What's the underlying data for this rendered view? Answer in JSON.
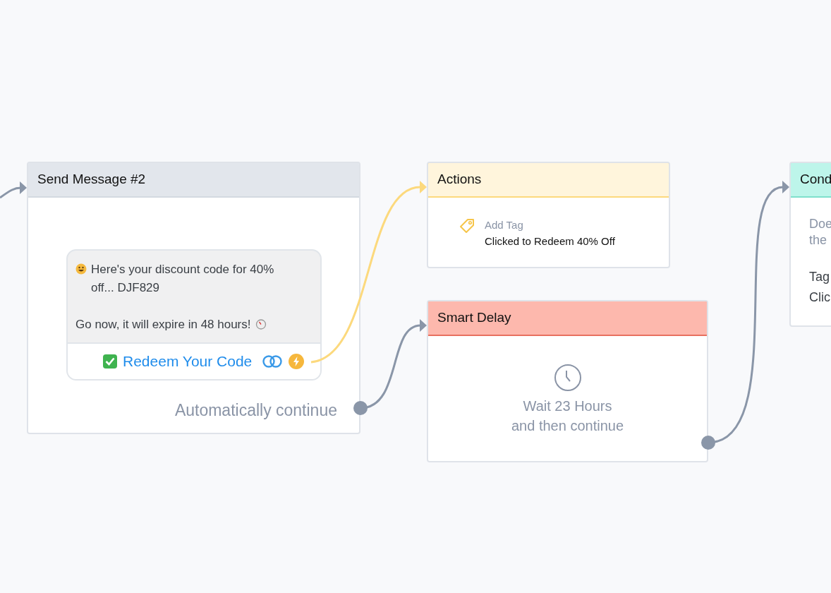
{
  "nodes": [
    {
      "kind": "message",
      "title": "Send Message #2",
      "lines": [
        "Here's your discount code for 40% off... DJF829",
        "Go now, it will expire in 48 hours!"
      ],
      "button": "Redeem Your Code",
      "footer": "Automatically continue"
    },
    {
      "kind": "action",
      "title": "Actions",
      "action_label": "Add Tag",
      "action_value": "Clicked to Redeem 40% Off"
    },
    {
      "kind": "delay",
      "title": "Smart Delay",
      "lines": [
        "Wait 23 Hours",
        "and then continue"
      ]
    },
    {
      "kind": "condition",
      "title": "Cond",
      "question": [
        "Doe",
        "the"
      ],
      "rule": [
        "Tag",
        "Clic"
      ]
    }
  ]
}
